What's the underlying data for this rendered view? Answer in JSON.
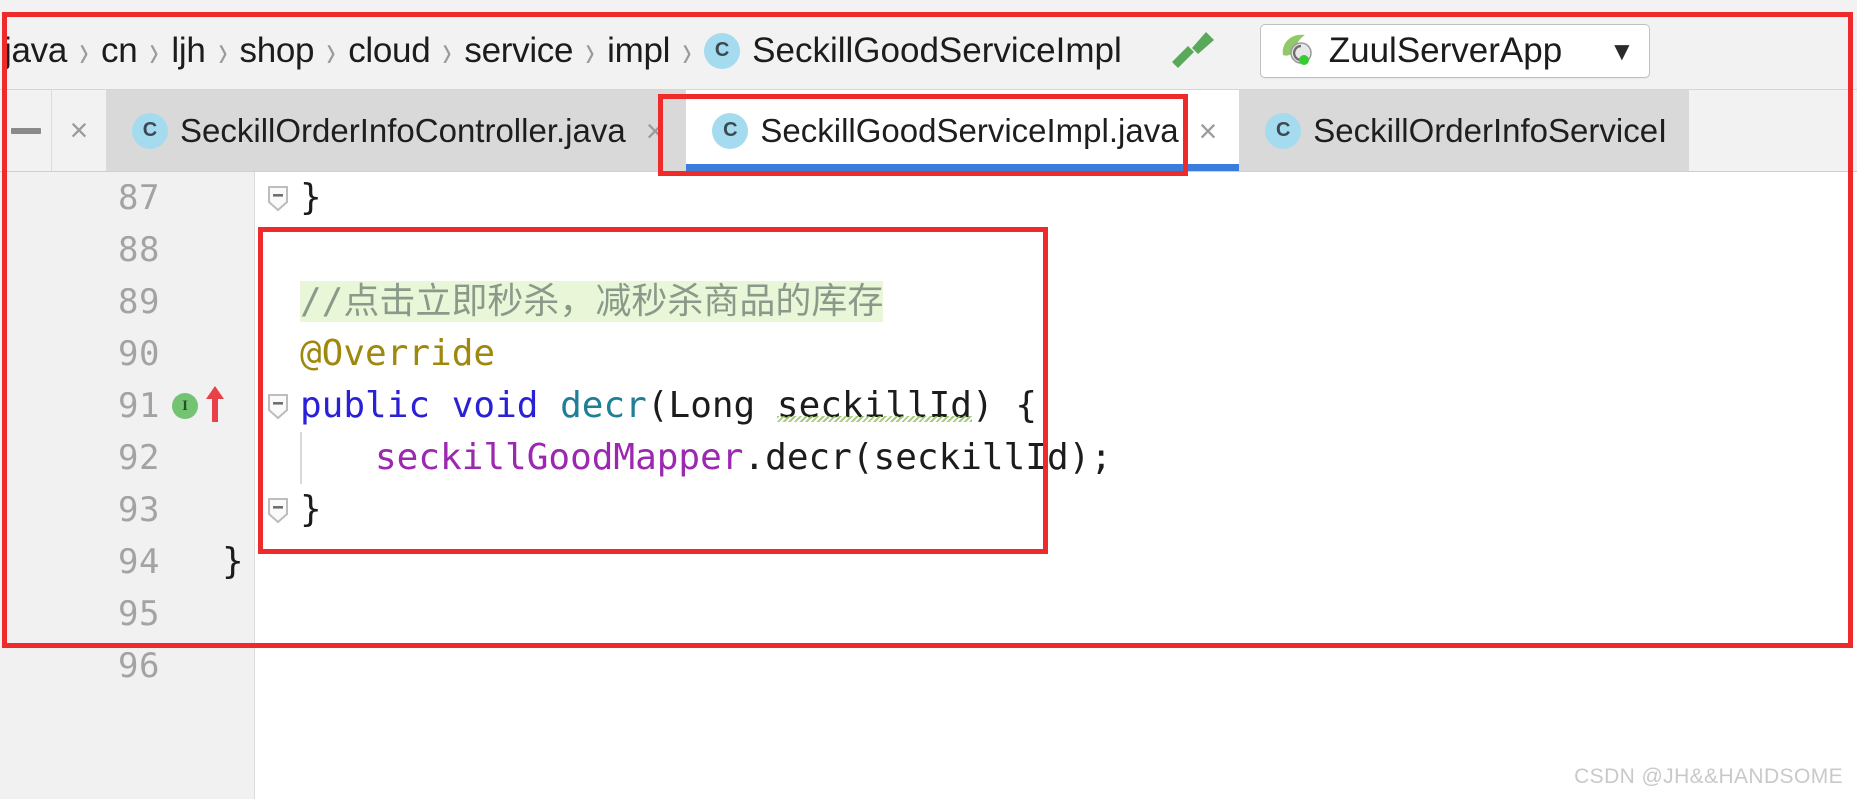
{
  "breadcrumb": {
    "separator": "›",
    "items": [
      {
        "label": "java"
      },
      {
        "label": "cn"
      },
      {
        "label": "ljh"
      },
      {
        "label": "shop"
      },
      {
        "label": "cloud"
      },
      {
        "label": "service"
      },
      {
        "label": "impl"
      }
    ],
    "current": {
      "icon_letter": "C",
      "label": "SeckillGoodServiceImpl"
    }
  },
  "toolbar": {
    "build_icon": "hammer-icon",
    "run_config": {
      "icon": "spring-boot-icon",
      "label": "ZuulServerApp",
      "caret": "▼"
    }
  },
  "tabs": {
    "close_glyph": "×",
    "items": [
      {
        "icon_letter": "C",
        "label": "SeckillOrderInfoController.java",
        "active": false
      },
      {
        "icon_letter": "C",
        "label": "SeckillGoodServiceImpl.java",
        "active": true
      },
      {
        "icon_letter": "C",
        "label": "SeckillOrderInfoServiceI",
        "active": false
      }
    ]
  },
  "editor": {
    "lines": [
      {
        "no": "87",
        "fold": "minus",
        "text": "    }"
      },
      {
        "no": "88",
        "fold": "",
        "text": ""
      },
      {
        "no": "89",
        "fold": "",
        "text": "    //点击立即秒杀，减秒杀商品的库存"
      },
      {
        "no": "90",
        "fold": "",
        "text": "    @Override"
      },
      {
        "no": "91",
        "fold": "minus",
        "text": "    public void decr(Long seckillId) {"
      },
      {
        "no": "92",
        "fold": "",
        "text": "        seckillGoodMapper.decr(seckillId);"
      },
      {
        "no": "93",
        "fold": "minus",
        "text": "    }"
      },
      {
        "no": "94",
        "fold": "",
        "text": "}"
      },
      {
        "no": "95",
        "fold": "",
        "text": ""
      },
      {
        "no": "96",
        "fold": "",
        "text": ""
      }
    ],
    "tokens": {
      "comment": "//点击立即秒杀，减秒杀商品的库存",
      "annotation": "@Override",
      "kw_public": "public",
      "kw_void": "void",
      "method_decr": "decr",
      "type_long": "Long",
      "param_seckillId": "seckillId",
      "field_mapper": "seckillGoodMapper",
      "call_decr": "decr",
      "arg_seckillId": "seckillId",
      "brace_open": "{",
      "brace_close": "}",
      "paren_open": "(",
      "paren_close": ")",
      "semicolon": ";"
    },
    "gutter_icons": {
      "line": "91",
      "implements": "implements-marker-icon",
      "implements_letter": "I",
      "override_arrow": "override-arrow-icon"
    }
  },
  "annotations": {
    "color": "#ef2a2a",
    "boxes": [
      {
        "name": "outer-highlight-box"
      },
      {
        "name": "active-tab-highlight-box"
      },
      {
        "name": "code-block-highlight-box"
      }
    ]
  },
  "watermark": {
    "text": "CSDN @JH&&HANDSOME"
  }
}
